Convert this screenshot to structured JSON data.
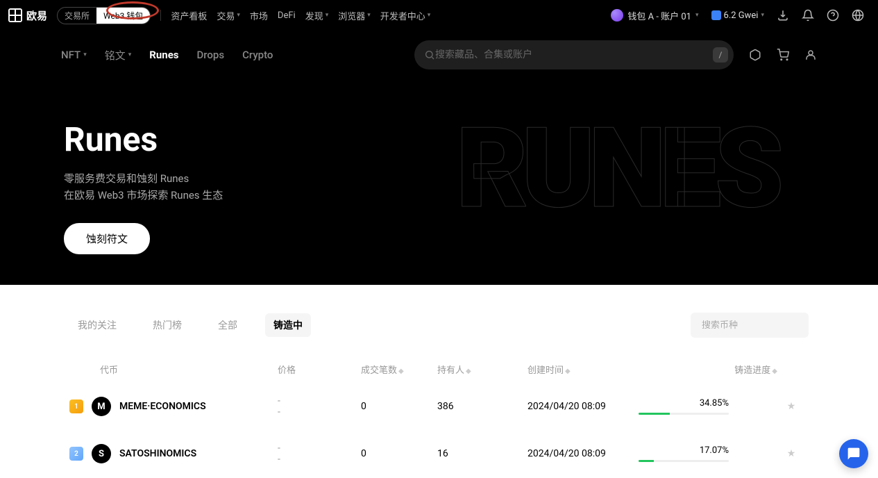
{
  "top_nav": {
    "brand": "欧易",
    "mode_exchange": "交易所",
    "mode_web3": "Web3 钱包",
    "links": {
      "assets": "资产看板",
      "trade": "交易",
      "market": "市场",
      "defi": "DeFi",
      "discover": "发现",
      "browser": "浏览器",
      "dev": "开发者中心"
    },
    "wallet_label": "钱包 A - 账户 01",
    "gwei": "6.2 Gwei"
  },
  "sub_nav": {
    "nft": "NFT",
    "inscriptions": "铭文",
    "runes": "Runes",
    "drops": "Drops",
    "crypto": "Crypto",
    "search_placeholder": "搜索藏品、合集或账户",
    "kbd": "/"
  },
  "hero": {
    "title": "Runes",
    "sub1": "零服务费交易和蚀刻 Runes",
    "sub2": "在欧易 Web3 市场探索 Runes 生态",
    "btn": "蚀刻符文",
    "art": "RUNES"
  },
  "filters": {
    "my_follow": "我的关注",
    "hot": "热门榜",
    "all": "全部",
    "minting": "铸造中",
    "search_placeholder": "搜索币种"
  },
  "table": {
    "headers": {
      "token": "代币",
      "price": "价格",
      "trades": "成交笔数",
      "holders": "持有人",
      "created": "创建时间",
      "progress": "铸造进度"
    },
    "rows": [
      {
        "rank": "1",
        "letter": "M",
        "name": "MEME·ECONOMICS",
        "price1": "-",
        "price2": "-",
        "trades": "0",
        "holders": "386",
        "created": "2024/04/20 08:09",
        "progress": "34.85%",
        "progress_width": "34.85%"
      },
      {
        "rank": "2",
        "letter": "S",
        "name": "SATOSHINOMICS",
        "price1": "-",
        "price2": "-",
        "trades": "0",
        "holders": "16",
        "created": "2024/04/20 08:09",
        "progress": "17.07%",
        "progress_width": "17.07%"
      }
    ]
  }
}
